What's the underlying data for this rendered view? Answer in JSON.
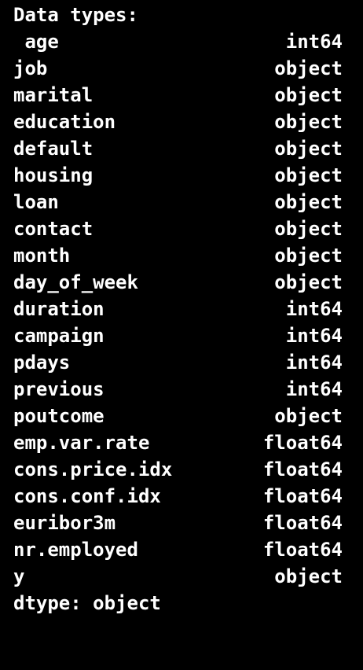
{
  "output": {
    "header": "Data types:",
    "rows": [
      {
        "name": " age",
        "dtype": "int64"
      },
      {
        "name": "job",
        "dtype": "object"
      },
      {
        "name": "marital",
        "dtype": "object"
      },
      {
        "name": "education",
        "dtype": "object"
      },
      {
        "name": "default",
        "dtype": "object"
      },
      {
        "name": "housing",
        "dtype": "object"
      },
      {
        "name": "loan",
        "dtype": "object"
      },
      {
        "name": "contact",
        "dtype": "object"
      },
      {
        "name": "month",
        "dtype": "object"
      },
      {
        "name": "day_of_week",
        "dtype": "object"
      },
      {
        "name": "duration",
        "dtype": "int64"
      },
      {
        "name": "campaign",
        "dtype": "int64"
      },
      {
        "name": "pdays",
        "dtype": "int64"
      },
      {
        "name": "previous",
        "dtype": "int64"
      },
      {
        "name": "poutcome",
        "dtype": "object"
      },
      {
        "name": "emp.var.rate",
        "dtype": "float64"
      },
      {
        "name": "cons.price.idx",
        "dtype": "float64"
      },
      {
        "name": "cons.conf.idx",
        "dtype": "float64"
      },
      {
        "name": "euribor3m",
        "dtype": "float64"
      },
      {
        "name": "nr.employed",
        "dtype": "float64"
      },
      {
        "name": "y",
        "dtype": "object"
      }
    ],
    "footer": "dtype: object"
  },
  "colors": {
    "background": "#000000",
    "text": "#ffffff"
  }
}
